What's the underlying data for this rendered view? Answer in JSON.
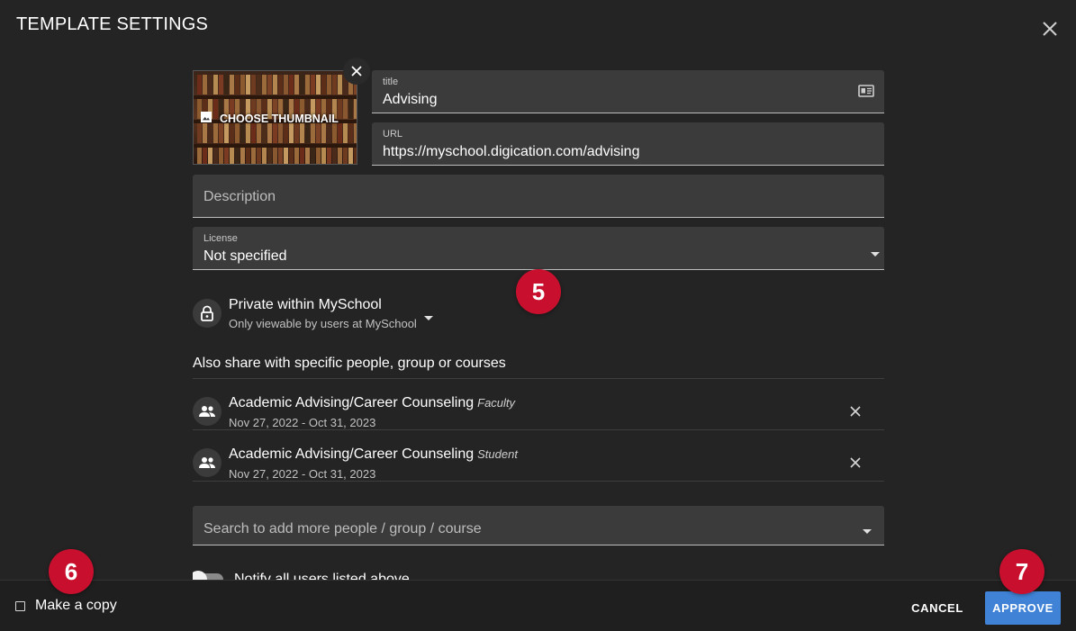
{
  "dialog": {
    "title": "TEMPLATE SETTINGS",
    "close_icon": "close-icon"
  },
  "thumbnail": {
    "label": "CHOOSE THUMBNAIL",
    "icon": "image-icon",
    "remove_icon": "close-icon"
  },
  "fields": {
    "title": {
      "label": "title",
      "value": "Advising",
      "icon": "id-card-icon"
    },
    "url": {
      "label": "URL",
      "value": "https://myschool.digication.com/advising"
    },
    "description": {
      "placeholder": "Description"
    },
    "license": {
      "label": "License",
      "value": "Not specified"
    }
  },
  "privacy": {
    "title": "Private within MySchool",
    "subtitle": "Only viewable by users at MySchool"
  },
  "share": {
    "heading": "Also share with specific people, group or courses",
    "items": [
      {
        "name": "Academic Advising/Career Counseling",
        "role": "Faculty",
        "dates": "Nov 27, 2022 - Oct 31, 2023"
      },
      {
        "name": "Academic Advising/Career Counseling",
        "role": "Student",
        "dates": "Nov 27, 2022 - Oct 31, 2023"
      }
    ],
    "search_placeholder": "Search to add more people / group / course"
  },
  "notify": {
    "label": "Notify all users listed above",
    "on": false
  },
  "footer": {
    "make_copy": "Make a copy",
    "cancel": "CANCEL",
    "approve": "APPROVE"
  },
  "markers": [
    "5",
    "6",
    "7"
  ],
  "colors": {
    "background": "#242424",
    "field": "#3b3b3b",
    "primary": "#3f82d6",
    "marker": "#c8102e"
  }
}
